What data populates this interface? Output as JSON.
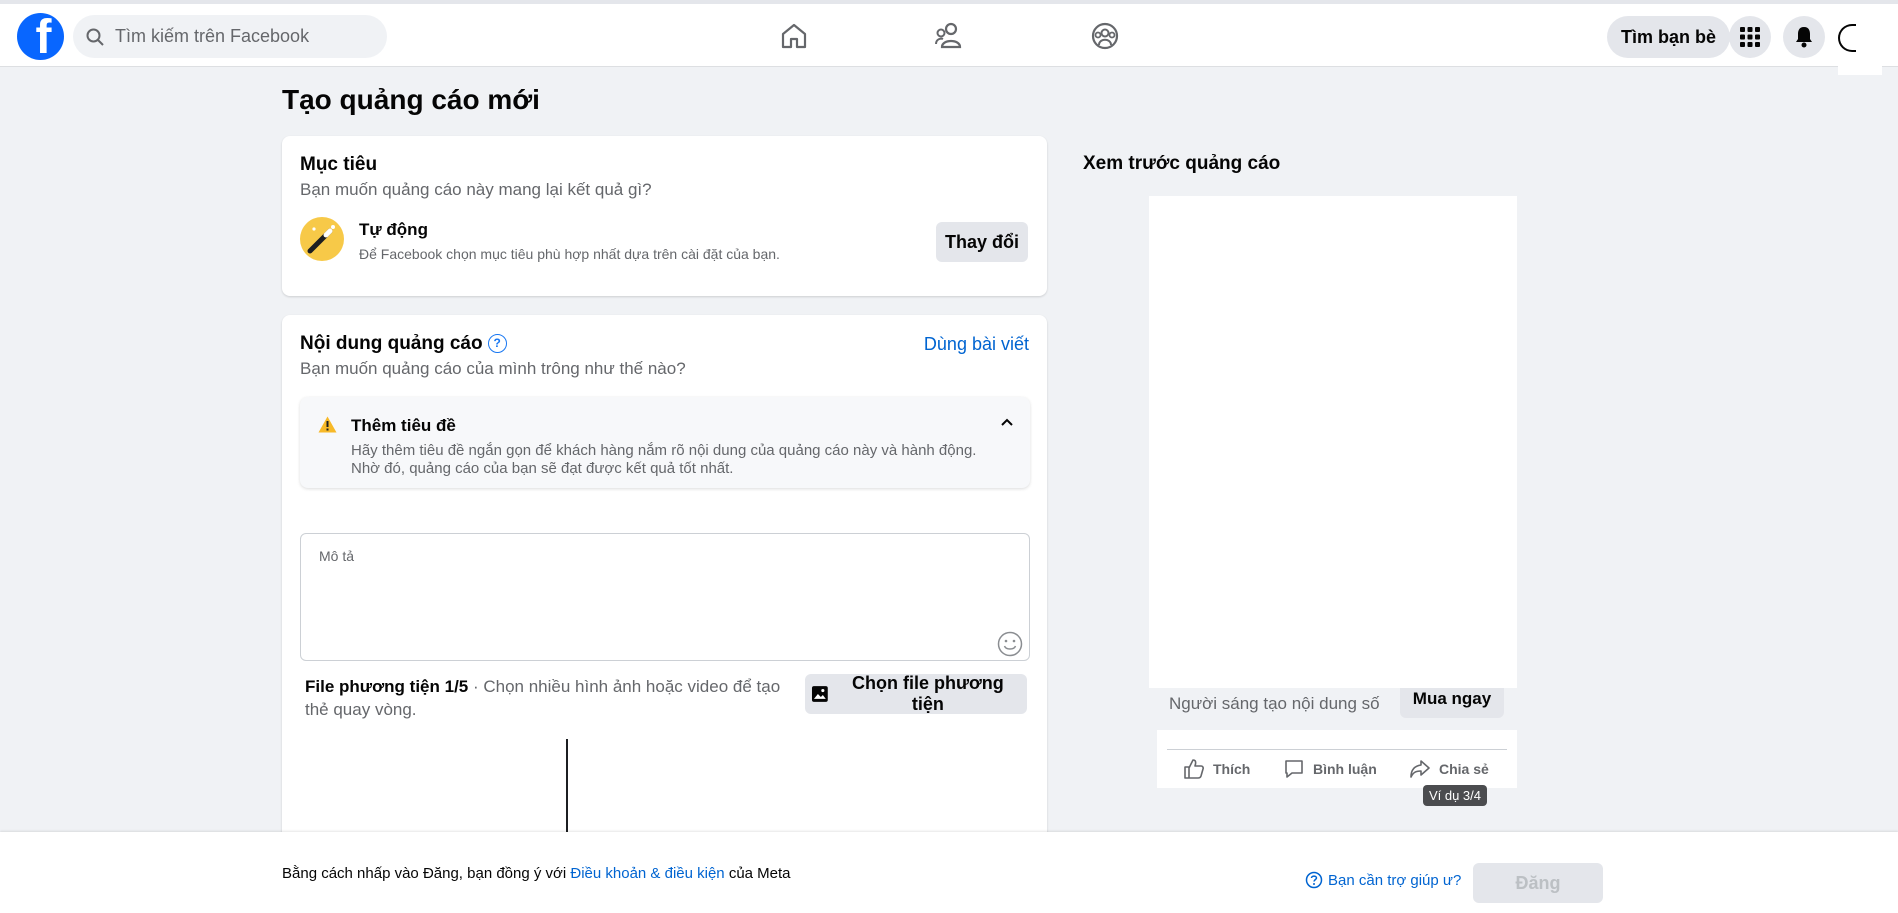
{
  "nav": {
    "search_placeholder": "Tìm kiếm trên Facebook",
    "find_friends_label": "Tìm bạn bè",
    "icons": [
      "home-icon",
      "friends-icon",
      "groups-icon",
      "menu-grid-icon",
      "notifications-icon"
    ]
  },
  "page": {
    "title": "Tạo quảng cáo mới"
  },
  "objective": {
    "heading": "Mục tiêu",
    "subtitle": "Bạn muốn quảng cáo này mang lại kết quả gì?",
    "name": "Tự động",
    "description": "Để Facebook chọn mục tiêu phù hợp nhất dựa trên cài đặt của bạn.",
    "change_label": "Thay đổi"
  },
  "content": {
    "heading": "Nội dung quảng cáo",
    "help_glyph": "?",
    "use_post_label": "Dùng bài viết",
    "subtitle": "Bạn muốn quảng cáo của mình trông như thế nào?",
    "warning": {
      "title": "Thêm tiêu đề",
      "text": "Hãy thêm tiêu đề ngắn gọn để khách hàng nắm rõ nội dung của quảng cáo này và hành động. Nhờ đó, quảng cáo của bạn sẽ đạt được kết quả tốt nhất."
    },
    "description_placeholder": "Mô tả",
    "media_label": "File phương tiện 1/5",
    "media_hint": " · Chọn nhiều hình ảnh hoặc video để tạo thẻ quay vòng.",
    "choose_media_label": "Chọn file phương tiện"
  },
  "preview": {
    "heading": "Xem trước quảng cáo",
    "creator": "Người sáng tạo nội dung số",
    "cta_label": "Mua ngay",
    "like_label": "Thích",
    "comment_label": "Bình luận",
    "share_label": "Chia sẻ",
    "example_badge": "Ví dụ 3/4"
  },
  "footer": {
    "terms_prefix": "Bằng cách nhấp vào Đăng, bạn đồng ý với ",
    "terms_link": "Điều khoản & điều kiện",
    "terms_suffix": " của Meta",
    "help_label": "Bạn cần trợ giúp ư?",
    "post_label": "Đăng"
  },
  "colors": {
    "brand_blue": "#0866ff",
    "link_blue": "#0064d1",
    "warning_yellow": "#f7b928",
    "page_bg": "#f0f2f5"
  }
}
